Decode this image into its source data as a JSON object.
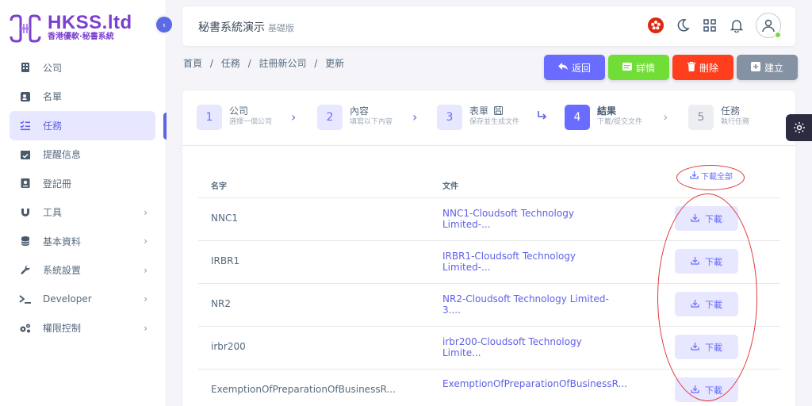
{
  "brand": {
    "title": "HKSS.ltd",
    "subtitle": "香港優軟·秘書系統"
  },
  "sidebar": {
    "items": [
      {
        "label": "公司",
        "icon": "building-icon"
      },
      {
        "label": "名單",
        "icon": "contact-card-icon"
      },
      {
        "label": "任務",
        "icon": "task-list-icon",
        "active": true
      },
      {
        "label": "提醒信息",
        "icon": "calendar-check-icon"
      },
      {
        "label": "登記冊",
        "icon": "register-book-icon"
      },
      {
        "label": "工具",
        "icon": "magnet-icon",
        "has_submenu": true
      },
      {
        "label": "基本資料",
        "icon": "database-icon",
        "has_submenu": true
      },
      {
        "label": "系統設置",
        "icon": "wrench-icon",
        "has_submenu": true
      },
      {
        "label": "Developer",
        "icon": "terminal-icon",
        "has_submenu": true
      },
      {
        "label": "權限控制",
        "icon": "cogs-icon",
        "has_submenu": true
      }
    ]
  },
  "navbar": {
    "title": "秘書系統演示",
    "edition": "基礎版",
    "icons": [
      "hk-flag-icon",
      "moon-icon",
      "grid-icon",
      "bell-icon",
      "user-avatar-icon"
    ]
  },
  "breadcrumb": [
    "首頁",
    "/",
    "任務",
    "/",
    "註冊新公司",
    "/",
    "更新"
  ],
  "actions": {
    "back": "返回",
    "detail": "詳情",
    "delete": "刪除",
    "create": "建立"
  },
  "steps": [
    {
      "num": "1",
      "title": "公司",
      "sub": "選擇一個公司",
      "state": "done"
    },
    {
      "num": "2",
      "title": "內容",
      "sub": "填寫以下內容",
      "state": "done"
    },
    {
      "num": "3",
      "title": "表單",
      "sub": "保存並生成文件",
      "state": "done"
    },
    {
      "num": "4",
      "title": "結果",
      "sub": "下載/提交文件",
      "state": "active"
    },
    {
      "num": "5",
      "title": "任務",
      "sub": "執行任務",
      "state": "todo"
    }
  ],
  "table": {
    "col_name": "名字",
    "col_file": "文件",
    "download_all": "下載全部",
    "download_label": "下載",
    "rows": [
      {
        "name": "NNC1",
        "file": "NNC1-Cloudsoft Technology Limited-..."
      },
      {
        "name": "IRBR1",
        "file": "IRBR1-Cloudsoft Technology Limited-..."
      },
      {
        "name": "NR2",
        "file": "NR2-Cloudsoft Technology Limited-3...."
      },
      {
        "name": "irbr200",
        "file": "irbr200-Cloudsoft Technology Limite..."
      },
      {
        "name": "ExemptionOfPreparationOfBusinessR...",
        "file": "ExemptionOfPreparationOfBusinessR..."
      }
    ]
  },
  "colors": {
    "primary": "#696cff",
    "success": "#71dd37",
    "danger": "#ff3e1d",
    "secondary": "#8592a3",
    "annotation": "#e2363a"
  }
}
